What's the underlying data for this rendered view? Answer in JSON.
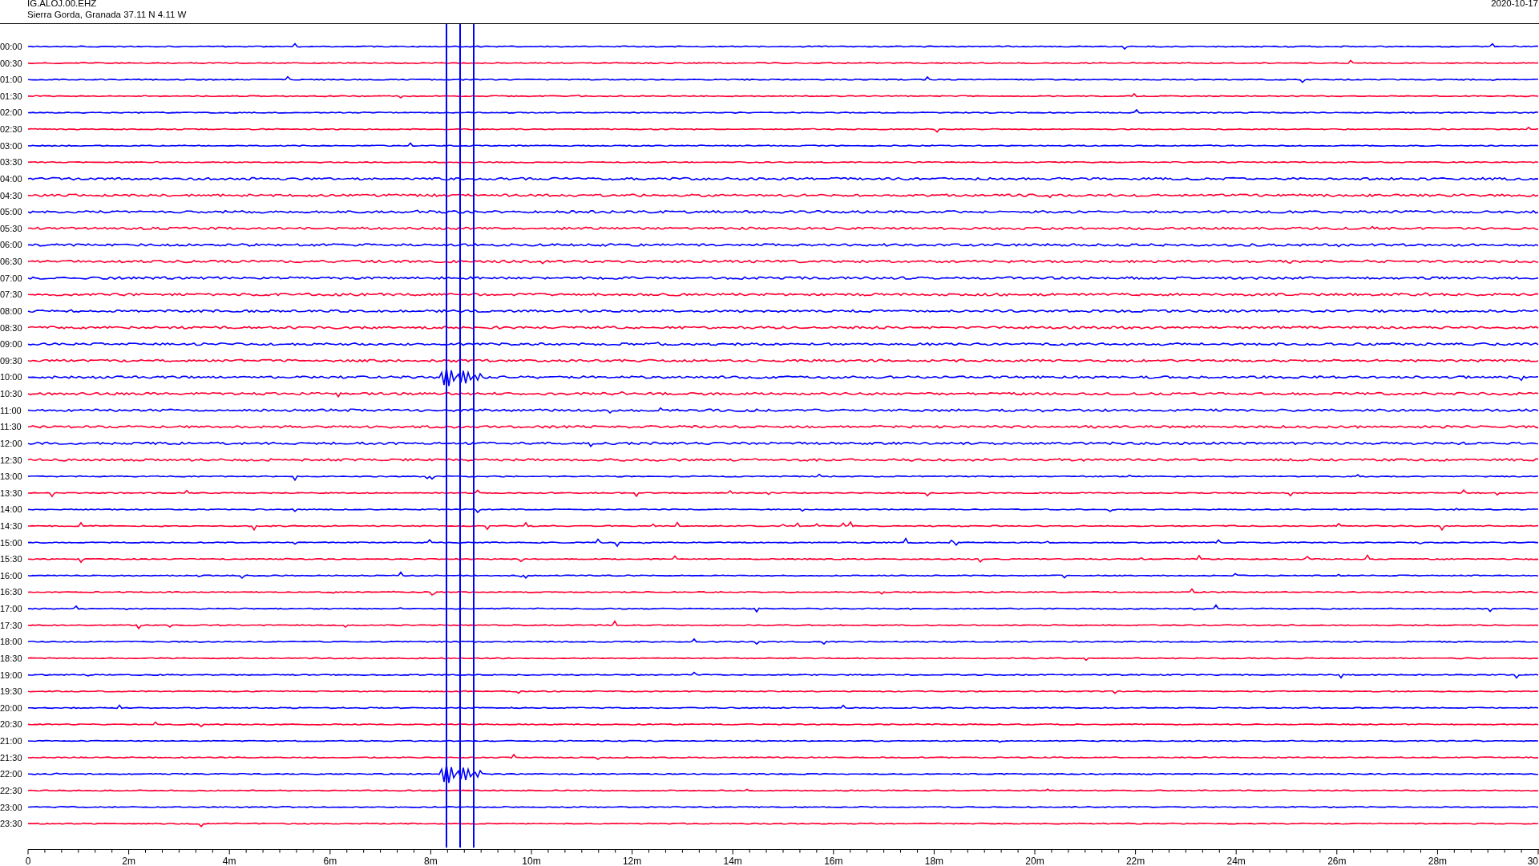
{
  "header": {
    "station": "IG.ALOJ.00.EHZ",
    "location": "Sierra Gorda, Granada  37.11 N 4.11 W",
    "date": "2020-10-17"
  },
  "traces": [
    {
      "label": "00:00",
      "color": "#0000ff"
    },
    {
      "label": "00:30",
      "color": "#ff0033"
    },
    {
      "label": "01:00",
      "color": "#0000ff"
    },
    {
      "label": "01:30",
      "color": "#ff0033"
    },
    {
      "label": "02:00",
      "color": "#0000ff"
    },
    {
      "label": "02:30",
      "color": "#ff0033"
    },
    {
      "label": "03:00",
      "color": "#0000ff"
    },
    {
      "label": "03:30",
      "color": "#ff0033"
    },
    {
      "label": "04:00",
      "color": "#0000ff"
    },
    {
      "label": "04:30",
      "color": "#ff0033"
    },
    {
      "label": "05:00",
      "color": "#0000ff"
    },
    {
      "label": "05:30",
      "color": "#ff0033"
    },
    {
      "label": "06:00",
      "color": "#0000ff"
    },
    {
      "label": "06:30",
      "color": "#ff0033"
    },
    {
      "label": "07:00",
      "color": "#0000ff"
    },
    {
      "label": "07:30",
      "color": "#ff0033"
    },
    {
      "label": "08:00",
      "color": "#0000ff"
    },
    {
      "label": "08:30",
      "color": "#ff0033"
    },
    {
      "label": "09:00",
      "color": "#0000ff"
    },
    {
      "label": "09:30",
      "color": "#ff0033"
    },
    {
      "label": "10:00",
      "color": "#0000ff"
    },
    {
      "label": "10:30",
      "color": "#ff0033"
    },
    {
      "label": "11:00",
      "color": "#0000ff"
    },
    {
      "label": "11:30",
      "color": "#ff0033"
    },
    {
      "label": "12:00",
      "color": "#0000ff"
    },
    {
      "label": "12:30",
      "color": "#ff0033"
    },
    {
      "label": "13:00",
      "color": "#0000ff"
    },
    {
      "label": "13:30",
      "color": "#ff0033"
    },
    {
      "label": "14:00",
      "color": "#0000ff"
    },
    {
      "label": "14:30",
      "color": "#ff0033"
    },
    {
      "label": "15:00",
      "color": "#0000ff"
    },
    {
      "label": "15:30",
      "color": "#ff0033"
    },
    {
      "label": "16:00",
      "color": "#0000ff"
    },
    {
      "label": "16:30",
      "color": "#ff0033"
    },
    {
      "label": "17:00",
      "color": "#0000ff"
    },
    {
      "label": "17:30",
      "color": "#ff0033"
    },
    {
      "label": "18:00",
      "color": "#0000ff"
    },
    {
      "label": "18:30",
      "color": "#ff0033"
    },
    {
      "label": "19:00",
      "color": "#0000ff"
    },
    {
      "label": "19:30",
      "color": "#ff0033"
    },
    {
      "label": "20:00",
      "color": "#0000ff"
    },
    {
      "label": "20:30",
      "color": "#ff0033"
    },
    {
      "label": "21:00",
      "color": "#0000ff"
    },
    {
      "label": "21:30",
      "color": "#ff0033"
    },
    {
      "label": "22:00",
      "color": "#0000ff"
    },
    {
      "label": "22:30",
      "color": "#ff0033"
    },
    {
      "label": "23:00",
      "color": "#0000ff"
    },
    {
      "label": "23:30",
      "color": "#ff0033"
    }
  ],
  "time_axis": {
    "labels": [
      "0",
      "2m",
      "4m",
      "6m",
      "8m",
      "10m",
      "12m",
      "14m",
      "16m",
      "18m",
      "20m",
      "22m",
      "24m",
      "26m",
      "28m",
      "30"
    ]
  }
}
